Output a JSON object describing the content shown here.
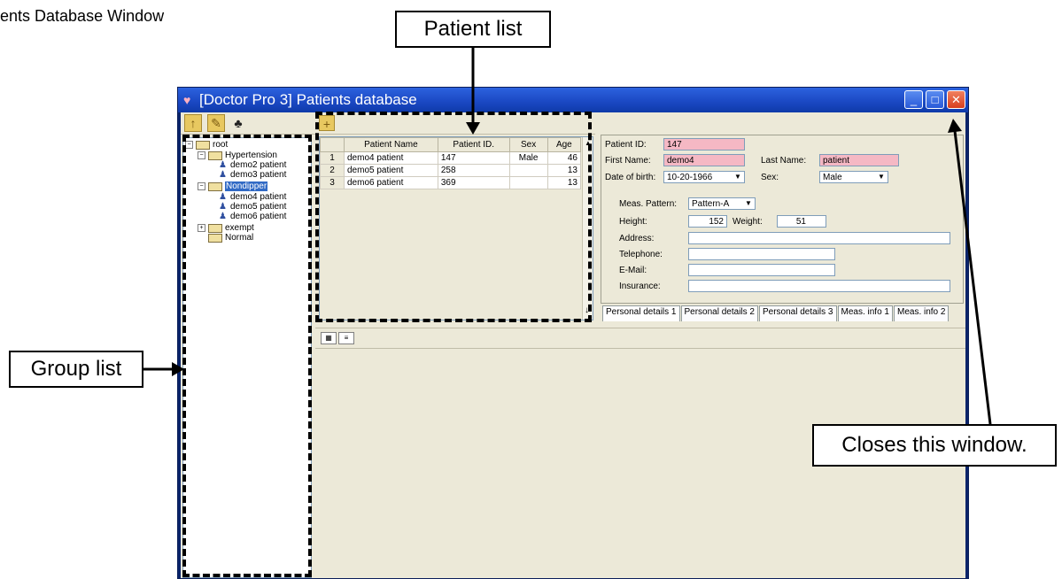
{
  "doc_heading": "ents Database Window",
  "callouts": {
    "patient_list": "Patient list",
    "group_list": "Group list",
    "close": "Closes this window."
  },
  "window": {
    "title": "[Doctor Pro 3] Patients database"
  },
  "group_tree": {
    "items": [
      {
        "label": "root",
        "level": 0,
        "type": "folder",
        "expander": "−"
      },
      {
        "label": "Hypertension",
        "level": 1,
        "type": "folder",
        "expander": "−"
      },
      {
        "label": "demo2 patient",
        "level": 2,
        "type": "patient"
      },
      {
        "label": "demo3 patient",
        "level": 2,
        "type": "patient"
      },
      {
        "label": "Nondipper",
        "level": 1,
        "type": "folder",
        "expander": "−",
        "selected": true
      },
      {
        "label": "demo4 patient",
        "level": 2,
        "type": "patient"
      },
      {
        "label": "demo5 patient",
        "level": 2,
        "type": "patient"
      },
      {
        "label": "demo6 patient",
        "level": 2,
        "type": "patient"
      },
      {
        "label": "exempt",
        "level": 1,
        "type": "folder",
        "expander": "+"
      },
      {
        "label": "Normal",
        "level": 1,
        "type": "folder"
      }
    ]
  },
  "patient_table": {
    "columns": [
      "Patient Name",
      "Patient ID.",
      "Sex",
      "Age"
    ],
    "rows": [
      {
        "num": "1",
        "name": "demo4 patient",
        "id": "147",
        "sex": "Male",
        "age": "46"
      },
      {
        "num": "2",
        "name": "demo5 patient",
        "id": "258",
        "sex": "",
        "age": "13"
      },
      {
        "num": "3",
        "name": "demo6 patient",
        "id": "369",
        "sex": "",
        "age": "13"
      }
    ]
  },
  "details": {
    "patient_id_label": "Patient ID:",
    "patient_id": "147",
    "first_name_label": "First Name:",
    "first_name": "demo4",
    "last_name_label": "Last Name:",
    "last_name": "patient",
    "dob_label": "Date of birth:",
    "dob": "10-20-1966",
    "sex_label": "Sex:",
    "sex": "Male",
    "meas_pattern_label": "Meas. Pattern:",
    "meas_pattern": "Pattern-A",
    "height_label": "Height:",
    "height": "152",
    "weight_label": "Weight:",
    "weight": "51",
    "address_label": "Address:",
    "address": "",
    "telephone_label": "Telephone:",
    "telephone": "",
    "email_label": "E-Mail:",
    "email": "",
    "insurance_label": "Insurance:",
    "insurance": ""
  },
  "tabs": [
    "Personal details 1",
    "Personal details 2",
    "Personal details 3",
    "Meas. info 1",
    "Meas. info 2"
  ],
  "colors": {
    "titlebar": "#1a47c2",
    "required_field": "#f5b8c4",
    "selection": "#316ac5",
    "panel": "#ece9d8"
  }
}
